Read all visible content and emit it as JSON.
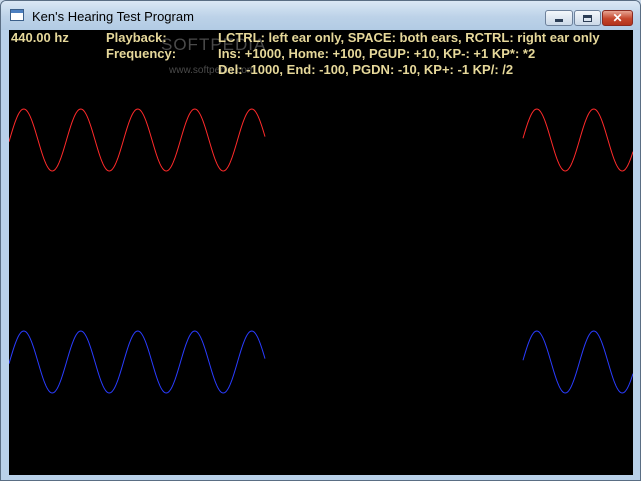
{
  "window": {
    "title": "Ken's Hearing Test Program",
    "icon": "app-window-icon",
    "controls": {
      "minimize_icon": "minimize-icon",
      "maximize_icon": "maximize-icon",
      "close_icon": "close-icon",
      "close_glyph": "✕"
    }
  },
  "hud": {
    "frequency_value": "440.00 hz",
    "playback_label": "Playback:",
    "playback_keys": "LCTRL: left ear only, SPACE: both ears, RCTRL: right ear only",
    "frequency_label": "Frequency:",
    "frequency_keys_1": "Ins: +1000, Home: +100, PGUP: +10, KP-: +1 KP*: *2",
    "frequency_keys_2": "Del: -1000, End:  -100, PGDN: -10, KP+: -1 KP/: /2"
  },
  "watermark": {
    "large": "SOFTPEDIA",
    "small": "www.softpedia.com"
  },
  "waves": {
    "left_channel_color": "#ff2a2a",
    "right_channel_color": "#2a3cff",
    "background": "#000000"
  }
}
